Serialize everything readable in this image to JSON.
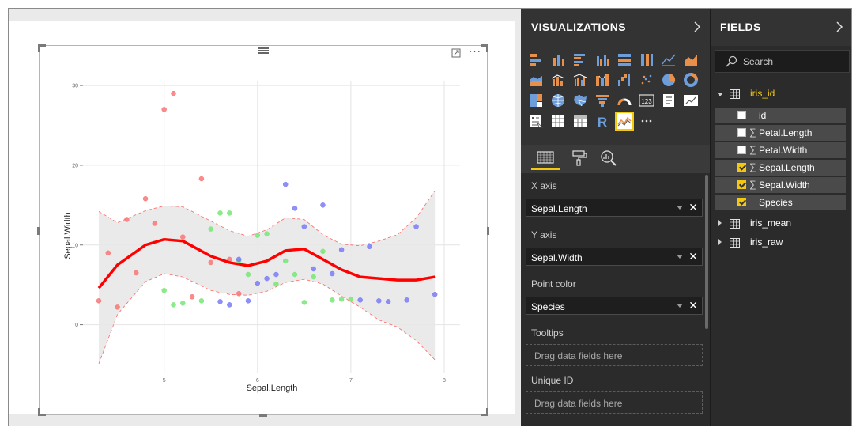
{
  "canvas": {
    "chart_data": {
      "type": "scatter",
      "xlabel": "Sepal.Length",
      "ylabel": "Sepal.Width",
      "x_ticks": [
        "5",
        "6",
        "7",
        "8"
      ],
      "y_ticks": [
        "0",
        "10",
        "20",
        "30"
      ],
      "xlim": [
        4.3,
        8.0
      ],
      "ylim": [
        -5,
        31
      ],
      "grid": true,
      "colors": {
        "setosa": "#f87777",
        "versicolor": "#77e877",
        "virginica": "#7b7bf8",
        "smooth": "#ff0000",
        "band_fill": "#e8e8e8",
        "band_edge": "#ff6666"
      },
      "series": [
        {
          "points": [
            [
              4.3,
              3.0
            ],
            [
              4.4,
              9.0
            ],
            [
              4.5,
              2.2
            ],
            [
              4.6,
              13.2
            ],
            [
              4.7,
              6.5
            ],
            [
              4.8,
              15.8
            ],
            [
              4.9,
              12.7
            ],
            [
              5.0,
              27.0
            ],
            [
              5.1,
              29.0
            ],
            [
              5.2,
              11.0
            ],
            [
              5.3,
              3.5
            ],
            [
              5.4,
              18.3
            ],
            [
              5.5,
              7.8
            ],
            [
              5.7,
              8.2
            ],
            [
              5.8,
              3.9
            ]
          ]
        },
        {
          "points": [
            [
              5.0,
              4.3
            ],
            [
              5.1,
              2.5
            ],
            [
              5.2,
              2.7
            ],
            [
              5.4,
              3.0
            ],
            [
              5.5,
              12.0
            ],
            [
              5.6,
              14.0
            ],
            [
              5.7,
              14.0
            ],
            [
              5.8,
              8.0
            ],
            [
              5.9,
              6.3
            ],
            [
              6.0,
              11.2
            ],
            [
              6.1,
              11.4
            ],
            [
              6.2,
              5.1
            ],
            [
              6.3,
              8.0
            ],
            [
              6.4,
              6.3
            ],
            [
              6.5,
              2.8
            ],
            [
              6.6,
              6.0
            ],
            [
              6.7,
              9.2
            ],
            [
              6.8,
              3.1
            ],
            [
              6.9,
              3.2
            ],
            [
              7.0,
              3.2
            ]
          ]
        },
        {
          "points": [
            [
              5.6,
              2.9
            ],
            [
              5.7,
              2.5
            ],
            [
              5.8,
              8.2
            ],
            [
              5.9,
              3.0
            ],
            [
              6.0,
              5.2
            ],
            [
              6.1,
              5.8
            ],
            [
              6.2,
              6.3
            ],
            [
              6.3,
              17.6
            ],
            [
              6.4,
              14.6
            ],
            [
              6.5,
              12.3
            ],
            [
              6.6,
              7.0
            ],
            [
              6.7,
              15.0
            ],
            [
              6.8,
              6.4
            ],
            [
              6.9,
              9.4
            ],
            [
              7.1,
              3.1
            ],
            [
              7.2,
              9.8
            ],
            [
              7.3,
              3.0
            ],
            [
              7.4,
              2.9
            ],
            [
              7.6,
              3.1
            ],
            [
              7.7,
              12.3
            ],
            [
              7.9,
              3.8
            ]
          ]
        }
      ],
      "smooth_line": [
        [
          4.3,
          4.6
        ],
        [
          4.5,
          7.5
        ],
        [
          4.8,
          10.0
        ],
        [
          5.0,
          10.7
        ],
        [
          5.2,
          10.5
        ],
        [
          5.5,
          8.6
        ],
        [
          5.7,
          7.8
        ],
        [
          5.9,
          7.4
        ],
        [
          6.1,
          8.0
        ],
        [
          6.3,
          9.3
        ],
        [
          6.5,
          9.5
        ],
        [
          6.7,
          8.2
        ],
        [
          6.9,
          6.9
        ],
        [
          7.1,
          6.0
        ],
        [
          7.3,
          5.8
        ],
        [
          7.5,
          5.6
        ],
        [
          7.7,
          5.6
        ],
        [
          7.9,
          6.0
        ]
      ],
      "band_upper": [
        [
          4.3,
          14.2
        ],
        [
          4.5,
          12.8
        ],
        [
          4.8,
          14.3
        ],
        [
          5.0,
          14.9
        ],
        [
          5.2,
          14.8
        ],
        [
          5.5,
          13.0
        ],
        [
          5.7,
          11.8
        ],
        [
          5.9,
          11.1
        ],
        [
          6.1,
          11.9
        ],
        [
          6.3,
          13.4
        ],
        [
          6.5,
          13.2
        ],
        [
          6.7,
          11.3
        ],
        [
          6.9,
          10.1
        ],
        [
          7.1,
          9.9
        ],
        [
          7.3,
          10.5
        ],
        [
          7.5,
          11.3
        ],
        [
          7.7,
          13.4
        ],
        [
          7.9,
          16.8
        ]
      ],
      "band_lower": [
        [
          4.3,
          -4.9
        ],
        [
          4.5,
          1.3
        ],
        [
          4.8,
          5.4
        ],
        [
          5.0,
          6.4
        ],
        [
          5.2,
          6.0
        ],
        [
          5.5,
          4.3
        ],
        [
          5.7,
          3.8
        ],
        [
          5.9,
          3.7
        ],
        [
          6.1,
          4.2
        ],
        [
          6.3,
          5.3
        ],
        [
          6.5,
          5.7
        ],
        [
          6.7,
          5.1
        ],
        [
          6.9,
          3.6
        ],
        [
          7.1,
          2.2
        ],
        [
          7.3,
          0.6
        ],
        [
          7.5,
          -0.3
        ],
        [
          7.7,
          -2.0
        ],
        [
          7.9,
          -4.4
        ]
      ]
    }
  },
  "visualizations": {
    "title": "VISUALIZATIONS",
    "icon_names": [
      "stacked-bar-icon",
      "stacked-column-icon",
      "clustered-bar-icon",
      "clustered-column-icon",
      "100-stacked-bar-icon",
      "100-stacked-column-icon",
      "line-chart-icon",
      "area-chart-icon",
      "stacked-area-icon",
      "line-column-icon",
      "line-clustered-column-icon",
      "ribbon-chart-icon",
      "waterfall-icon",
      "scatter-icon",
      "pie-icon",
      "donut-icon",
      "treemap-icon",
      "map-icon",
      "filled-map-icon",
      "funnel-icon",
      "gauge-icon",
      "card-icon",
      "multi-row-card-icon",
      "kpi-icon",
      "slicer-icon",
      "table-icon",
      "matrix-icon",
      "r-visual-icon",
      "custom-visual-icon",
      "more-visuals-icon"
    ],
    "wells": {
      "x_axis_label": "X axis",
      "x_axis_value": "Sepal.Length",
      "y_axis_label": "Y axis",
      "y_axis_value": "Sepal.Width",
      "point_color_label": "Point color",
      "point_color_value": "Species",
      "tooltips_label": "Tooltips",
      "tooltips_placeholder": "Drag data fields here",
      "unique_id_label": "Unique ID",
      "unique_id_placeholder": "Drag data fields here"
    }
  },
  "fields": {
    "title": "FIELDS",
    "search_placeholder": "Search",
    "tables": [
      {
        "name": "iris_id",
        "expanded": true,
        "fields": [
          {
            "name": "id",
            "checked": false,
            "sigma": false
          },
          {
            "name": "Petal.Length",
            "checked": false,
            "sigma": true
          },
          {
            "name": "Petal.Width",
            "checked": false,
            "sigma": true
          },
          {
            "name": "Sepal.Length",
            "checked": true,
            "sigma": true
          },
          {
            "name": "Sepal.Width",
            "checked": true,
            "sigma": true
          },
          {
            "name": "Species",
            "checked": true,
            "sigma": false
          }
        ]
      },
      {
        "name": "iris_mean",
        "expanded": false,
        "fields": []
      },
      {
        "name": "iris_raw",
        "expanded": false,
        "fields": []
      }
    ],
    "sigma_glyph": "∑"
  },
  "theme": {
    "accent": "#f2c811",
    "pane_dark": "#333333"
  }
}
